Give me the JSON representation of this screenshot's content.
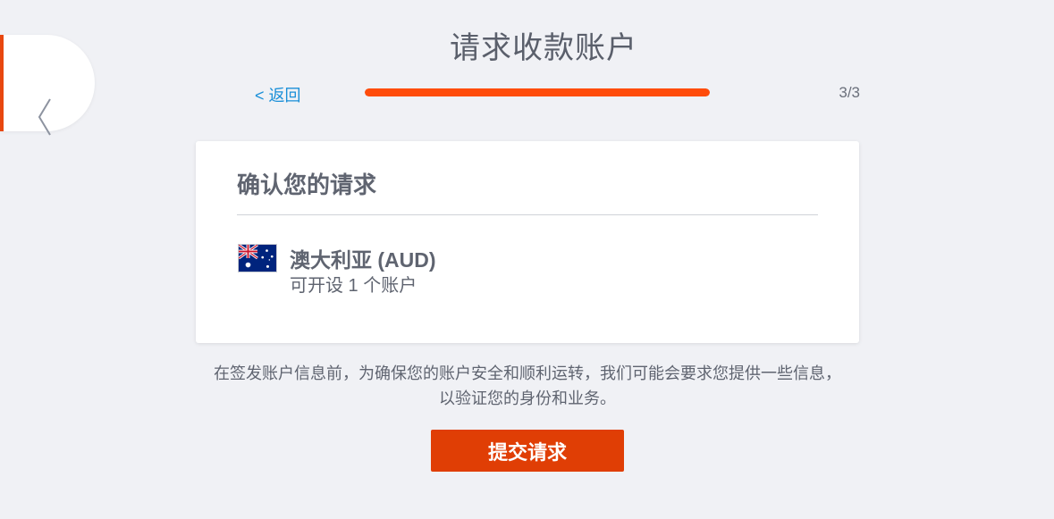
{
  "header": {
    "title": "请求收款账户",
    "back_link": "< 返回",
    "step": "3/3",
    "progress": 1.0
  },
  "side_nav": {
    "back_icon": "chevron-left-icon"
  },
  "card": {
    "title": "确认您的请求",
    "currency": {
      "flag": "australia-flag-icon",
      "name": "澳大利亚 (AUD)",
      "detail": "可开设 1 个账户"
    }
  },
  "notice": {
    "line1": "在签发账户信息前，为确保您的账户安全和顺利运转，我们可能会要求您提供一些信息，",
    "line2": "以验证您的身份和业务。"
  },
  "actions": {
    "submit_label": "提交请求"
  },
  "colors": {
    "accent": "#ff4c0b",
    "button": "#e03e05",
    "link": "#1a8fd8",
    "background": "#f0f1f5"
  }
}
